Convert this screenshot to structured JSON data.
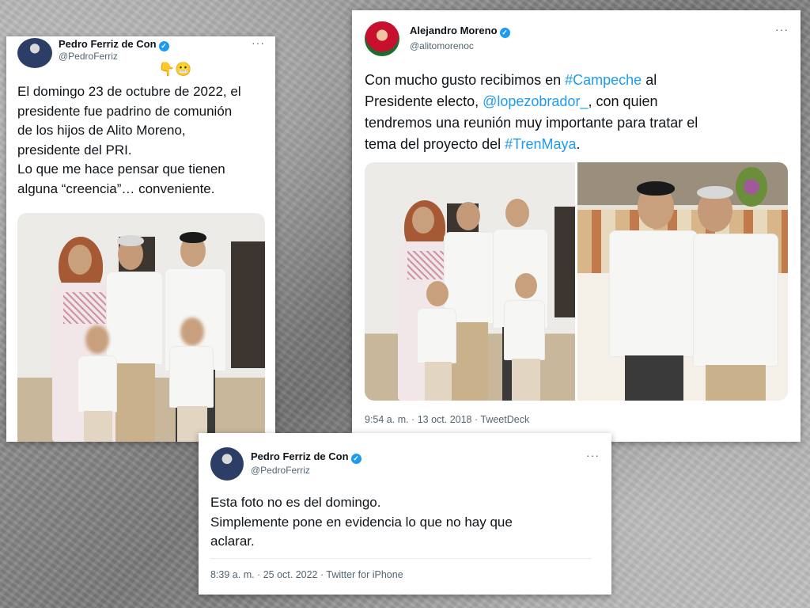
{
  "tweet_left": {
    "author_name": "Pedro Ferriz de Con",
    "author_handle": "@PedroFerriz",
    "emoji": "👇😬",
    "text_lines": [
      "El domingo 23 de octubre de 2022, el",
      "presidente fue padrino de comunión",
      "de los hijos de Alito Moreno,",
      "presidente del PRI.",
      "Lo que me hace pensar que tienen",
      "alguna “creencia”… conveniente."
    ],
    "more_label": "···",
    "avatar_icon": "avatar-icon"
  },
  "tweet_right": {
    "author_name": "Alejandro Moreno",
    "author_handle": "@alitomorenoc",
    "text_parts": {
      "l1_a": "Con mucho gusto recibimos en ",
      "l1_link": "#Campeche",
      "l1_b": " al",
      "l2_a": "Presidente electo, ",
      "l2_link": "@lopezobrador_",
      "l2_b": ", con quien",
      "l3": "tendremos una reunión muy importante para tratar el",
      "l4_a": "tema del proyecto del ",
      "l4_link": "#TrenMaya",
      "l4_b": "."
    },
    "meta": "9:54 a. m. · 13 oct. 2018 · TweetDeck",
    "more_label": "···"
  },
  "tweet_bottom": {
    "author_name": "Pedro Ferriz de Con",
    "author_handle": "@PedroFerriz",
    "text_lines": [
      "Esta foto no es del domingo.",
      "Simplemente pone en evidencia lo que no hay que",
      "aclarar."
    ],
    "meta": "8:39 a. m. · 25 oct. 2022 · Twitter for iPhone",
    "more_label": "···"
  },
  "colors": {
    "link": "#1d9bf0",
    "verified": "#1d9bf0",
    "text": "#0f1419",
    "secondary": "#536471"
  },
  "verified_glyph": "✓"
}
